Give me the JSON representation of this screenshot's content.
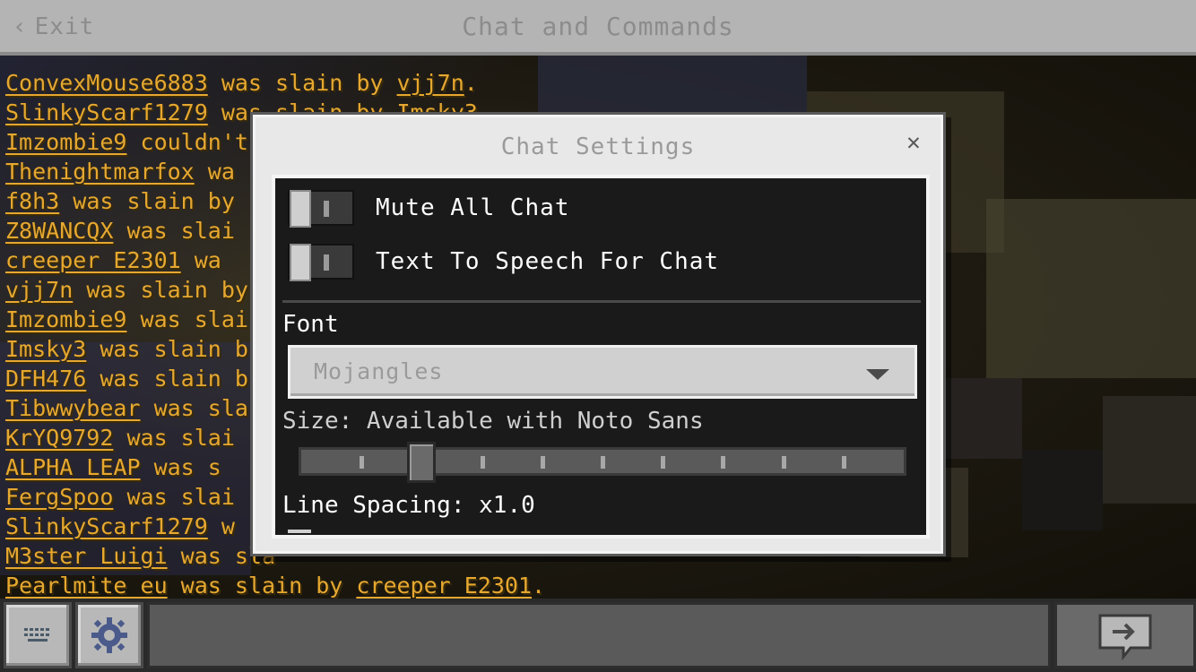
{
  "header": {
    "exit_label": "Exit",
    "title": "Chat and Commands"
  },
  "chat": {
    "lines": [
      {
        "player": "ConvexMouse6883",
        "text": " was slain by ",
        "killer": "vjj7n",
        "end": "."
      },
      {
        "player": "SlinkyScarf1279",
        "text": " was slain by ",
        "killer": "Imsky3",
        "end": ""
      },
      {
        "player": "Imzombie9",
        "text": " couldn't",
        "killer": "",
        "end": ""
      },
      {
        "player": "Thenightmarfox",
        "text": " wa",
        "killer": "",
        "end": ""
      },
      {
        "player": "f8h3",
        "text": " was slain by",
        "killer": "",
        "end": ""
      },
      {
        "player": "Z8WANCQX",
        "text": " was slai",
        "killer": "",
        "end": ""
      },
      {
        "player": "creeper E2301",
        "text": " wa",
        "killer": "",
        "end": ""
      },
      {
        "player": "vjj7n",
        "text": " was slain by",
        "killer": "",
        "end": ""
      },
      {
        "player": "Imzombie9",
        "text": " was slai",
        "killer": "",
        "end": ""
      },
      {
        "player": "Imsky3",
        "text": " was slain b",
        "killer": "",
        "end": ""
      },
      {
        "player": "DFH476",
        "text": " was slain b",
        "killer": "",
        "end": ""
      },
      {
        "player": "Tibwwybear",
        "text": " was sla",
        "killer": "",
        "end": ""
      },
      {
        "player": "KrYQ9792",
        "text": " was slai",
        "killer": "",
        "end": ""
      },
      {
        "player": "ALPHA LEAP",
        "text": " was s",
        "killer": "",
        "end": ""
      },
      {
        "player": "FergSpoo",
        "text": " was slai",
        "killer": "",
        "end": ""
      },
      {
        "player": "SlinkyScarf1279",
        "text": " w",
        "killer": "",
        "end": ""
      },
      {
        "player": "M3ster Luigi",
        "text": " was sla",
        "killer": "",
        "end": ""
      },
      {
        "player": "Pearlmite eu",
        "text": " was slain by ",
        "killer": "creeper E2301",
        "end": "."
      }
    ]
  },
  "modal": {
    "title": "Chat Settings",
    "close_icon": "close-icon",
    "mute_all_label": "Mute All Chat",
    "mute_all_on": false,
    "tts_label": "Text To Speech For Chat",
    "tts_on": false,
    "font_label": "Font",
    "font_value": "Mojangles",
    "size_label": "Size: Available with Noto Sans",
    "size_value": 2,
    "size_steps": 10,
    "line_spacing_label": "Line Spacing: x1.0"
  },
  "bottom": {
    "keyboard_icon": "keyboard-icon",
    "settings_icon": "gear-icon",
    "input_placeholder": "",
    "send_icon": "send-arrow-icon"
  },
  "colors": {
    "chat_text": "#e6a830",
    "header_bg": "#b4b4b4",
    "modal_bg": "#e8e8e8",
    "panel_bg": "#1a1a1a"
  }
}
